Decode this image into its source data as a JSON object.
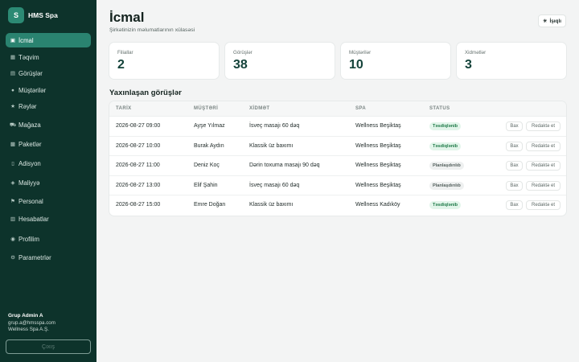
{
  "brand": {
    "logo_letter": "S",
    "name": "HMS Spa"
  },
  "nav": [
    {
      "label": "İcmal",
      "icon": "▣",
      "active": true
    },
    {
      "label": "Təqvim",
      "icon": "▦"
    },
    {
      "label": "Görüşlər",
      "icon": "▤"
    },
    {
      "label": "Müştərilər",
      "icon": "●"
    },
    {
      "label": "Rəylər",
      "icon": "★"
    },
    {
      "label": "Mağaza",
      "icon": "⛟"
    },
    {
      "label": "Paketlər",
      "icon": "▩"
    },
    {
      "label": "Adisyon",
      "icon": "▯"
    },
    {
      "label": "Maliyyə",
      "icon": "◈"
    },
    {
      "label": "Personal",
      "icon": "⚑"
    },
    {
      "label": "Hesabatlar",
      "icon": "▥"
    },
    {
      "label": "Profilim",
      "icon": "◉"
    },
    {
      "label": "Parametrlər",
      "icon": "⚙"
    }
  ],
  "user": {
    "name": "Grup Admin A",
    "email": "grup.a@hmsspa.com",
    "company": "Wellness Spa A.Ş."
  },
  "logout_label": "Çıxış",
  "page": {
    "title": "İcmal",
    "subtitle": "Şirkətinizin məlumatlarının xülasəsi",
    "exit_icon": "☀",
    "exit_label": "İşıqlı"
  },
  "stats": [
    {
      "label": "Filiallar",
      "value": "2"
    },
    {
      "label": "Görüşlər",
      "value": "38"
    },
    {
      "label": "Müştərilər",
      "value": "10"
    },
    {
      "label": "Xidmətlər",
      "value": "3"
    }
  ],
  "upcoming": {
    "title": "Yaxınlaşan görüşlər",
    "columns": [
      "TARİX",
      "MÜŞTƏRİ",
      "XİDMƏT",
      "SPA",
      "STATUS"
    ],
    "view_label": "Bax",
    "edit_label": "Redaktə et",
    "rows": [
      {
        "date": "2026-08-27 09:00",
        "customer": "Ayşe Yılmaz",
        "service": "İsveç masajı 60 dəq",
        "spa": "Wellness Beşiktaş",
        "status": "Təsdiqlənib",
        "status_type": "ok"
      },
      {
        "date": "2026-08-27 10:00",
        "customer": "Burak Aydın",
        "service": "Klassik üz baxımı",
        "spa": "Wellness Beşiktaş",
        "status": "Təsdiqlənib",
        "status_type": "ok"
      },
      {
        "date": "2026-08-27 11:00",
        "customer": "Deniz Koç",
        "service": "Dərin toxuma masajı 90 dəq",
        "spa": "Wellness Beşiktaş",
        "status": "Planlaşdırılıb",
        "status_type": "plan"
      },
      {
        "date": "2026-08-27 13:00",
        "customer": "Elif Şahin",
        "service": "İsveç masajı 60 dəq",
        "spa": "Wellness Beşiktaş",
        "status": "Planlaşdırılıb",
        "status_type": "plan"
      },
      {
        "date": "2026-08-27 15:00",
        "customer": "Emre Doğan",
        "service": "Klassik üz baxımı",
        "spa": "Wellness Kadıköy",
        "status": "Təsdiqlənib",
        "status_type": "ok"
      }
    ]
  },
  "colors": {
    "sidebar_bg": "#0d332b",
    "accent": "#2a8370",
    "confirmed_bg": "#e2f5ea",
    "confirmed_text": "#1f7a48"
  }
}
